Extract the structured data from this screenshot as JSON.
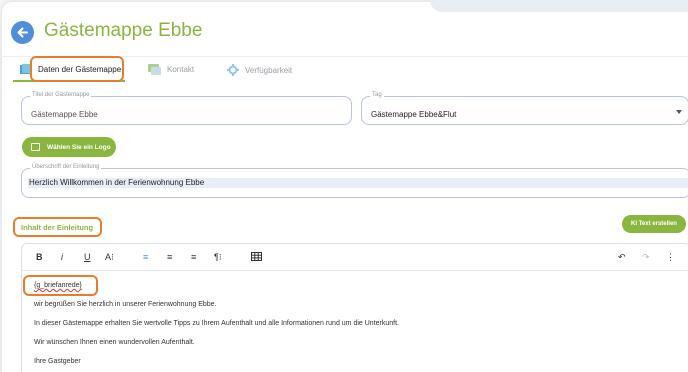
{
  "header": {
    "title": "Gästemappe Ebbe"
  },
  "tabs": [
    {
      "label": "Daten der Gästemappe",
      "icon": "book-icon",
      "active": true
    },
    {
      "label": "Kontakt",
      "icon": "contact-card-icon",
      "active": false
    },
    {
      "label": "Verfügbarkeit",
      "icon": "gear-icon",
      "active": false
    }
  ],
  "form": {
    "title_field": {
      "label": "Titel der Gästemappe",
      "value": "Gästemappe Ebbe"
    },
    "tag_field": {
      "label": "Tag",
      "value": "Gästemappe Ebbe&Flut"
    },
    "logo_button": "Wählen Sie ein Logo",
    "intro_heading_field": {
      "label": "Überschrift der Einleitung",
      "value": "Herzlich Willkommen in der Ferienwohnung Ebbe"
    },
    "intro_content_label": "Inhalt der Einleitung",
    "ai_button": "KI Text erstellen"
  },
  "editor": {
    "toolbar": {
      "bold": "B",
      "italic": "i",
      "underline": "U",
      "font_size": "A⁝",
      "align_left": "≡",
      "align_center": "≡",
      "align_right": "≡",
      "paragraph": "¶⁝",
      "table": "table-icon",
      "undo": "↶",
      "redo": "↷",
      "more": "⋮"
    },
    "lines": [
      "{g_briefanrede}",
      "wir begrüßen Sie herzlich in unserer Ferienwohnung Ebbe.",
      "In dieser Gästemappe erhalten Sie wertvolle Tipps zu Ihrem Aufenthalt und alle Informationen rund um die Unterkunft.",
      "Wir wünschen Ihnen einen wundervollen Aufenthalt.",
      "Ihre Gastgeber"
    ]
  },
  "colors": {
    "accent_green": "#8ab640",
    "highlight_orange": "#e87e2c",
    "back_blue": "#4f8fd9",
    "field_border": "#b9c3e6"
  }
}
